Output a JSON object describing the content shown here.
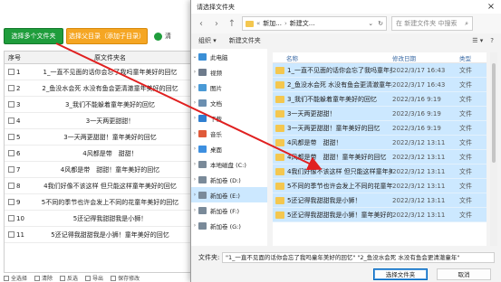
{
  "app": {
    "buttons": {
      "select_folders": "选择多个文件夹",
      "select_parent": "选择父目录（添加子目录）",
      "extra": "清"
    },
    "table": {
      "headers": {
        "index": "序号",
        "name": "原文件夹名"
      },
      "rows": [
        {
          "index": "1",
          "name": "1_一直不见面的话你会忘了我吗童年美好的回忆"
        },
        {
          "index": "2",
          "name": "2_鱼没水会死 水没有鱼会更清澈童年美好的回忆"
        },
        {
          "index": "3",
          "name": "3_我们不能躲着童年美好的回忆"
        },
        {
          "index": "4",
          "name": "3一天两更甜甜！"
        },
        {
          "index": "5",
          "name": "3一天两更甜甜！童年美好的回忆"
        },
        {
          "index": "6",
          "name": "4风都是带　甜甜！"
        },
        {
          "index": "7",
          "name": "4风都是带　甜甜！童年美好的回忆"
        },
        {
          "index": "8",
          "name": "4我们好像不该这样 但只能这样童年美好的回忆"
        },
        {
          "index": "9",
          "name": "5不同的季节也许会发上不同的花童年美好的回忆"
        },
        {
          "index": "10",
          "name": "5还记得我甜甜我是小狮！"
        },
        {
          "index": "11",
          "name": "5还记得我甜甜我是小狮！童年美好的回忆"
        }
      ]
    },
    "footer": [
      "全选择",
      "清除",
      "反选",
      "导出",
      "保存修改"
    ]
  },
  "dialog": {
    "title": "请选择文件夹",
    "close": "×",
    "nav_back": "‹",
    "nav_forward": "›",
    "nav_up": "↑",
    "address": {
      "root": "«",
      "part1": "新加...",
      "part2": "新建文..."
    },
    "search_placeholder": "在 新建文件夹 中搜索",
    "search_icon": "⌕",
    "toolbar": {
      "organize": "组织 ▾",
      "new_folder": "新建文件夹",
      "view": "☰ ▾",
      "help": "?"
    },
    "tree": [
      {
        "label": "此电脑",
        "icon": "computer-icon",
        "color": "#3b8fd6"
      },
      {
        "label": "视频",
        "icon": "video-icon",
        "color": "#6e7b8c"
      },
      {
        "label": "图片",
        "icon": "picture-icon",
        "color": "#4a9ad6"
      },
      {
        "label": "文档",
        "icon": "document-icon",
        "color": "#6b8fb0"
      },
      {
        "label": "下载",
        "icon": "download-icon",
        "color": "#2f7fd1"
      },
      {
        "label": "音乐",
        "icon": "music-icon",
        "color": "#e05a3a"
      },
      {
        "label": "桌面",
        "icon": "desktop-icon",
        "color": "#3d8fe0"
      },
      {
        "label": "本地磁盘 (C:)",
        "icon": "disk-icon",
        "color": "#7a8a99"
      },
      {
        "label": "新加卷 (D:)",
        "icon": "disk-icon",
        "color": "#7a8a99"
      },
      {
        "label": "新加卷 (E:)",
        "icon": "disk-icon",
        "color": "#7a8a99"
      },
      {
        "label": "新加卷 (F:)",
        "icon": "disk-icon",
        "color": "#7a8a99"
      },
      {
        "label": "新加卷 (G:)",
        "icon": "disk-icon",
        "color": "#7a8a99"
      }
    ],
    "columns": {
      "name": "名称",
      "date": "修改日期",
      "type": "类型"
    },
    "files": [
      {
        "name": "1_一直不见面的话你会忘了我吗童年美好...",
        "date": "2022/3/17 16:43",
        "type": "文件"
      },
      {
        "name": "2_鱼没水会死 水没有鱼会更清澈童年美好...",
        "date": "2022/3/17 16:43",
        "type": "文件"
      },
      {
        "name": "3_我们不能躲着童年美好的回忆",
        "date": "2022/3/16 9:19",
        "type": "文件"
      },
      {
        "name": "3一天两更甜甜！",
        "date": "2022/3/16 9:19",
        "type": "文件"
      },
      {
        "name": "3一天两更甜甜！童年美好的回忆",
        "date": "2022/3/16 9:19",
        "type": "文件"
      },
      {
        "name": "4风都是带　甜甜！",
        "date": "2022/3/12 13:11",
        "type": "文件"
      },
      {
        "name": "4风都是带　甜甜！童年美好的回忆",
        "date": "2022/3/12 13:11",
        "type": "文件"
      },
      {
        "name": "4我们好像不该这样 但只能这样童年美好...",
        "date": "2022/3/12 13:11",
        "type": "文件"
      },
      {
        "name": "5不同的季节也许会发上不同的花童年美好...",
        "date": "2022/3/12 13:11",
        "type": "文件"
      },
      {
        "name": "5还记得我甜甜我是小狮！",
        "date": "2022/3/12 13:11",
        "type": "文件"
      },
      {
        "name": "5还记得我甜甜我是小狮！童年美好的回忆",
        "date": "2022/3/12 13:11",
        "type": "文件"
      }
    ],
    "filename_label": "文件夹:",
    "filename_value": "\"1_一直不见面的话你会忘了我吗童年美好的回忆\" \"2_鱼没水会死 水没有鱼会更清澈童年\"",
    "ok": "选择文件夹",
    "cancel": "取消"
  }
}
